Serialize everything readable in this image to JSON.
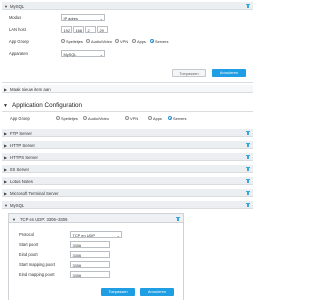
{
  "mysql_panel": {
    "title": "MySQL",
    "modus_label": "Modus",
    "modus_value": "IP adres",
    "lan_host_label": "LAN host",
    "lan_host_octets": [
      "192",
      "168",
      "2",
      "29"
    ],
    "app_group_label": "App Groep",
    "app_group_options": [
      "Spelletjes",
      "Audio/Video",
      "VPN",
      "Apps",
      "Servers"
    ],
    "app_group_selected": "Servers",
    "apparaten_label": "Apparaten",
    "apparaten_value": "MySQL",
    "cancel_label": "Toepassen",
    "apply_label": "Annuleren"
  },
  "show_items_label": "Maak nieuw item aan",
  "app_config": {
    "title": "Application Configuration",
    "app_group_label": "App Groep",
    "app_group_options": [
      "Spelletjes",
      "Audio/Video",
      "VPN",
      "Apps",
      "Servers"
    ],
    "app_group_selected": "Servers",
    "rows": [
      "FTP Server",
      "HTTP Server",
      "HTTPS Server",
      "IIS Server",
      "Lotus Notes",
      "Microsoft Terminal Server",
      "MySQL"
    ]
  },
  "rule": {
    "title": "TCP en UDP: 3306–3306",
    "protocol_label": "Protocol",
    "protocol_value": "TCP en UDP",
    "start_port_label": "Start poort",
    "start_port_value": "3306",
    "end_port_label": "Eind poort",
    "end_port_value": "3306",
    "start_mapping_label": "Start mapping poort",
    "start_mapping_value": "3306",
    "end_mapping_label": "Eind mapping poort",
    "end_mapping_value": "3306",
    "apply_label": "Toepassen",
    "cancel_label": "Annuleren"
  },
  "colors": {
    "accent": "#1f9ee3",
    "header_bg": "#eceff1",
    "border": "#dadde0"
  }
}
